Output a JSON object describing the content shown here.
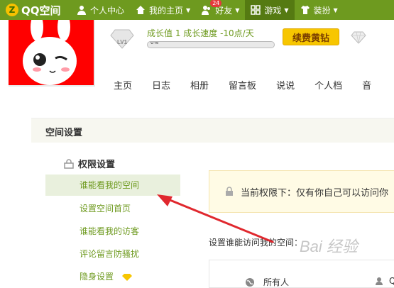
{
  "topbar": {
    "logo_text": "QQ空间",
    "items": [
      {
        "label": "个人中心",
        "icon": "person-icon"
      },
      {
        "label": "我的主页",
        "icon": "home-icon"
      },
      {
        "label": "好友",
        "icon": "friends-icon",
        "badge": "24"
      },
      {
        "label": "游戏",
        "icon": "grid-icon"
      },
      {
        "label": "装扮",
        "icon": "shirt-icon"
      }
    ]
  },
  "profile": {
    "level": "LV1",
    "growth_text": "成长值 1   成长速度 -10点/天",
    "progress_label": "0%",
    "progress_value": 0,
    "vip_button": "续费黄钻"
  },
  "mainnav": [
    "主页",
    "日志",
    "相册",
    "留言板",
    "说说",
    "个人档",
    "音"
  ],
  "settings": {
    "title": "空间设置",
    "section": "权限设置",
    "items": [
      "谁能看我的空间",
      "设置空间首页",
      "谁能看我的访客",
      "评论留言防骚扰",
      "隐身设置"
    ],
    "notice": "当前权限下：仅有你自己可以访问你",
    "prompt": "设置谁能访问我的空间：",
    "options": [
      "所有人",
      "Q"
    ]
  },
  "watermark": "Bai 经验",
  "colors": {
    "brand": "#6e9a1f",
    "accent": "#f7c600",
    "arrow": "#e0282e"
  }
}
